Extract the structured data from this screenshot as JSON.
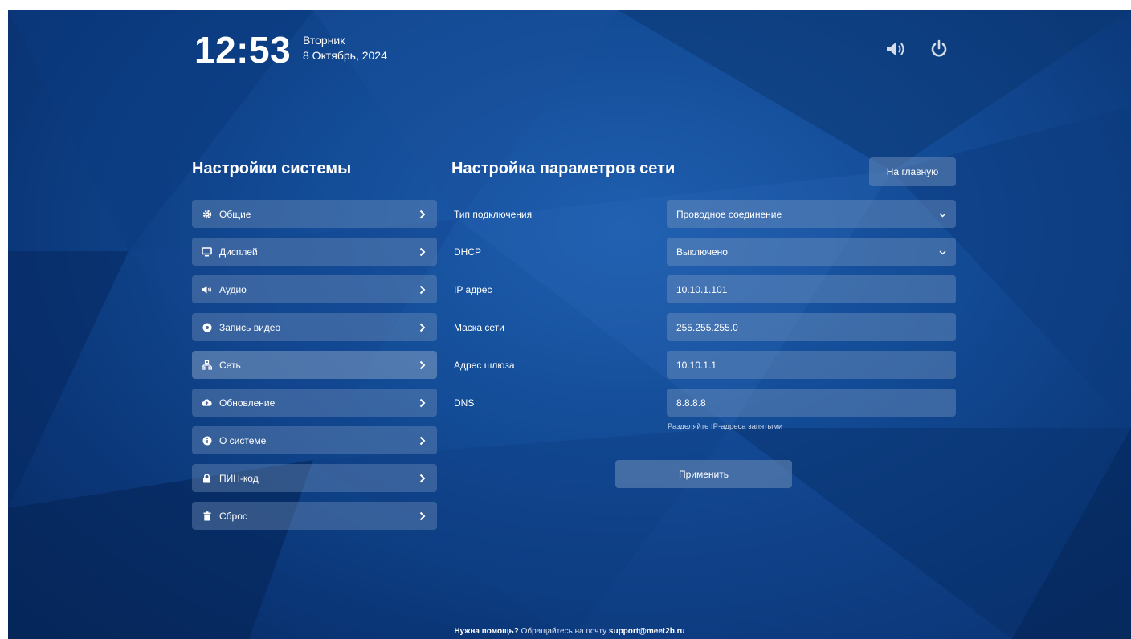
{
  "header": {
    "time": "12:53",
    "weekday": "Вторник",
    "date": "8 Октябрь, 2024",
    "sound_icon": "volume-icon",
    "power_icon": "power-icon"
  },
  "sidebar": {
    "title": "Настройки системы",
    "items": [
      {
        "label": "Общие",
        "icon": "gear-icon"
      },
      {
        "label": "Дисплей",
        "icon": "monitor-icon"
      },
      {
        "label": "Аудио",
        "icon": "volume-icon"
      },
      {
        "label": "Запись видео",
        "icon": "record-icon"
      },
      {
        "label": "Сеть",
        "icon": "network-icon"
      },
      {
        "label": "Обновление",
        "icon": "cloud-upload-icon"
      },
      {
        "label": "О системе",
        "icon": "info-icon"
      },
      {
        "label": "ПИН-код",
        "icon": "lock-icon"
      },
      {
        "label": "Сброс",
        "icon": "trash-icon"
      }
    ],
    "active_item": "Сеть"
  },
  "network": {
    "title": "Настройка параметров сети",
    "home_button": "На главную",
    "connection_type": {
      "label": "Тип подключения",
      "value": "Проводное соединение"
    },
    "dhcp": {
      "label": "DHCP",
      "value": "Выключено"
    },
    "ip": {
      "label": "IP адрес",
      "value": "10.10.1.101"
    },
    "mask": {
      "label": "Маска сети",
      "value": "255.255.255.0"
    },
    "gateway": {
      "label": "Адрес шлюза",
      "value": "10.10.1.1"
    },
    "dns": {
      "label": "DNS",
      "value": "8.8.8.8",
      "hint": "Разделяйте IP-адреса запятыми"
    },
    "apply_button": "Применить"
  },
  "footer": {
    "help": "Нужна помощь?",
    "text": "Обращайтесь на почту",
    "email": "support@meet2b.ru"
  }
}
